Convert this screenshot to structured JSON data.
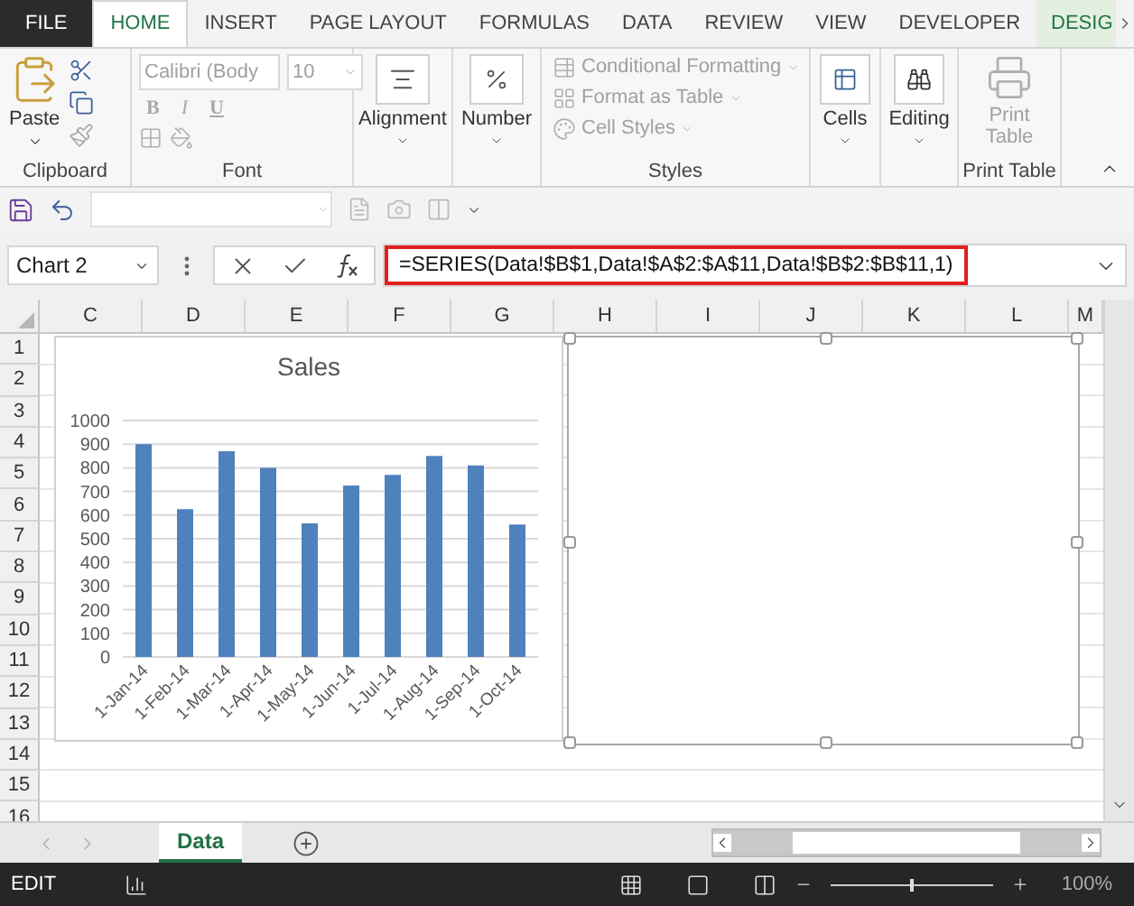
{
  "ribbon_tabs": [
    {
      "label": "FILE",
      "kind": "file",
      "selected": false
    },
    {
      "label": "HOME",
      "kind": "normal",
      "selected": true
    },
    {
      "label": "INSERT",
      "kind": "normal",
      "selected": false
    },
    {
      "label": "PAGE LAYOUT",
      "kind": "normal",
      "selected": false
    },
    {
      "label": "FORMULAS",
      "kind": "normal",
      "selected": false
    },
    {
      "label": "DATA",
      "kind": "normal",
      "selected": false
    },
    {
      "label": "REVIEW",
      "kind": "normal",
      "selected": false
    },
    {
      "label": "VIEW",
      "kind": "normal",
      "selected": false
    },
    {
      "label": "DEVELOPER",
      "kind": "normal",
      "selected": false
    },
    {
      "label": "DESIG",
      "kind": "contextual",
      "selected": false
    }
  ],
  "clipboard": {
    "label": "Clipboard",
    "paste": "Paste"
  },
  "font": {
    "label": "Font",
    "disabled": true,
    "font_name": "Calibri (Body",
    "font_size": "10",
    "buttons": [
      "B",
      "I",
      "U"
    ]
  },
  "alignment": {
    "label": "Alignment"
  },
  "number": {
    "label": "Number"
  },
  "styles": {
    "label": "Styles",
    "disabled": true,
    "items": [
      "Conditional Formatting",
      "Format as Table",
      "Cell Styles"
    ]
  },
  "cells": {
    "label": "Cells"
  },
  "editing": {
    "label": "Editing"
  },
  "print_table": {
    "label": "Print Table",
    "button": "Print Table",
    "disabled": true
  },
  "name_box": "Chart 2",
  "formula": "=SERIES(Data!$B$1,Data!$A$2:$A$11,Data!$B$2:$B$11,1)",
  "columns": [
    "C",
    "D",
    "E",
    "F",
    "G",
    "H",
    "I",
    "J",
    "K",
    "L",
    "M"
  ],
  "rows": [
    "1",
    "2",
    "3",
    "4",
    "5",
    "6",
    "7",
    "8",
    "9",
    "10",
    "11",
    "12",
    "13",
    "14",
    "15",
    "16"
  ],
  "chart": {
    "chart_data": {
      "type": "bar",
      "title": "Sales",
      "grid": true,
      "categories": [
        "1-Jan-14",
        "1-Feb-14",
        "1-Mar-14",
        "1-Apr-14",
        "1-May-14",
        "1-Jun-14",
        "1-Jul-14",
        "1-Aug-14",
        "1-Sep-14",
        "1-Oct-14"
      ],
      "series": [
        {
          "color": "#4f81bd",
          "values": [
            900,
            625,
            870,
            800,
            565,
            725,
            770,
            850,
            810,
            560
          ]
        }
      ],
      "ylim": [
        0,
        1000
      ],
      "yticks": [
        0,
        100,
        200,
        300,
        400,
        500,
        600,
        700,
        800,
        900,
        1000
      ]
    }
  },
  "selected_chart": {
    "selected": true
  },
  "sheet_tabs": [
    {
      "label": "Data",
      "selected": true
    }
  ],
  "status": "EDIT",
  "zoom_slider": {
    "level": 0.5
  },
  "zoom": "100%"
}
